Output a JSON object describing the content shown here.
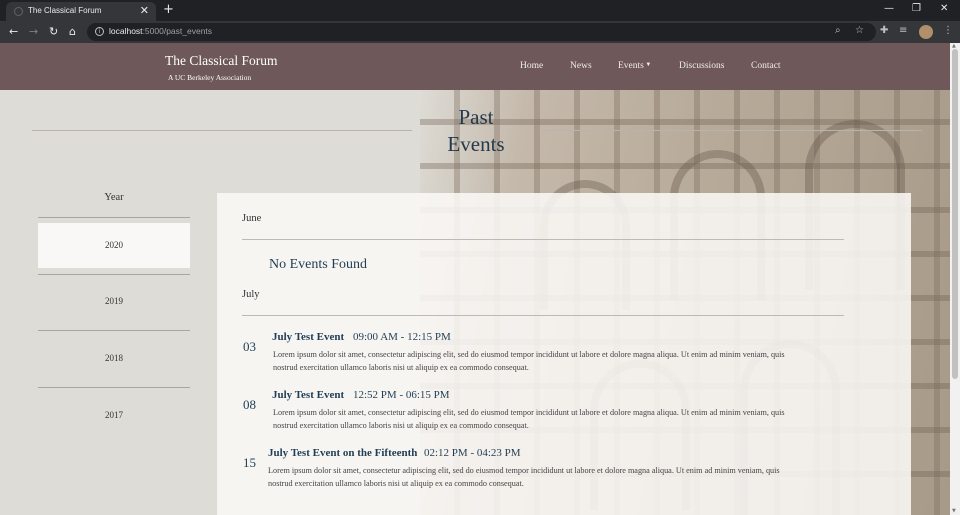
{
  "browser": {
    "tab_title": "The Classical Forum",
    "tab_close": "✕",
    "new_tab": "+",
    "url_host": "localhost",
    "url_path": ":5000/past_events",
    "back": "←",
    "forward": "→",
    "reload": "↻",
    "home": "⌂",
    "minimize": "—",
    "restore": "❐",
    "close": "✕"
  },
  "site": {
    "brand": "The Classical Forum",
    "subtitle": "A UC Berkeley Association",
    "nav": [
      "Home",
      "News",
      "Events",
      "Discussions",
      "Contact"
    ]
  },
  "page": {
    "title_line1": "Past",
    "title_line2": "Events"
  },
  "sidebar": {
    "heading": "Year",
    "years": [
      "2020",
      "2019",
      "2018",
      "2017"
    ],
    "active_year": "2020"
  },
  "events": {
    "june": {
      "month": "June",
      "empty_message": "No Events Found"
    },
    "july": {
      "month": "July",
      "items": [
        {
          "day": "03",
          "title": "July Test Event",
          "time": "09:00 AM - 12:15 PM",
          "desc_line1": "Lorem ipsum dolor sit amet, consectetur adipiscing elit, sed do eiusmod tempor incididunt ut labore et dolore magna aliqua. Ut enim ad minim veniam, quis",
          "desc_line2": "nostrud exercitation ullamco laboris nisi ut aliquip ex ea commodo consequat."
        },
        {
          "day": "08",
          "title": "July Test Event",
          "time": "12:52 PM - 06:15 PM",
          "desc_line1": "Lorem ipsum dolor sit amet, consectetur adipiscing elit, sed do eiusmod tempor incididunt ut labore et dolore magna aliqua. Ut enim ad minim veniam, quis",
          "desc_line2": "nostrud exercitation ullamco laboris nisi ut aliquip ex ea commodo consequat."
        },
        {
          "day": "15",
          "title": "July Test Event on the Fifteenth",
          "time": "02:12 PM - 04:23 PM",
          "desc_line1": "Lorem ipsum dolor sit amet, consectetur adipiscing elit, sed do eiusmod tempor incididunt ut labore et dolore magna aliqua. Ut enim ad minim veniam, quis",
          "desc_line2": "nostrud exercitation ullamco laboris nisi ut aliquip ex ea commodo consequat."
        }
      ]
    }
  },
  "colors": {
    "navbar": "#6e5859",
    "accent_text": "#1f3e55",
    "page_bg": "#dedcd6"
  }
}
